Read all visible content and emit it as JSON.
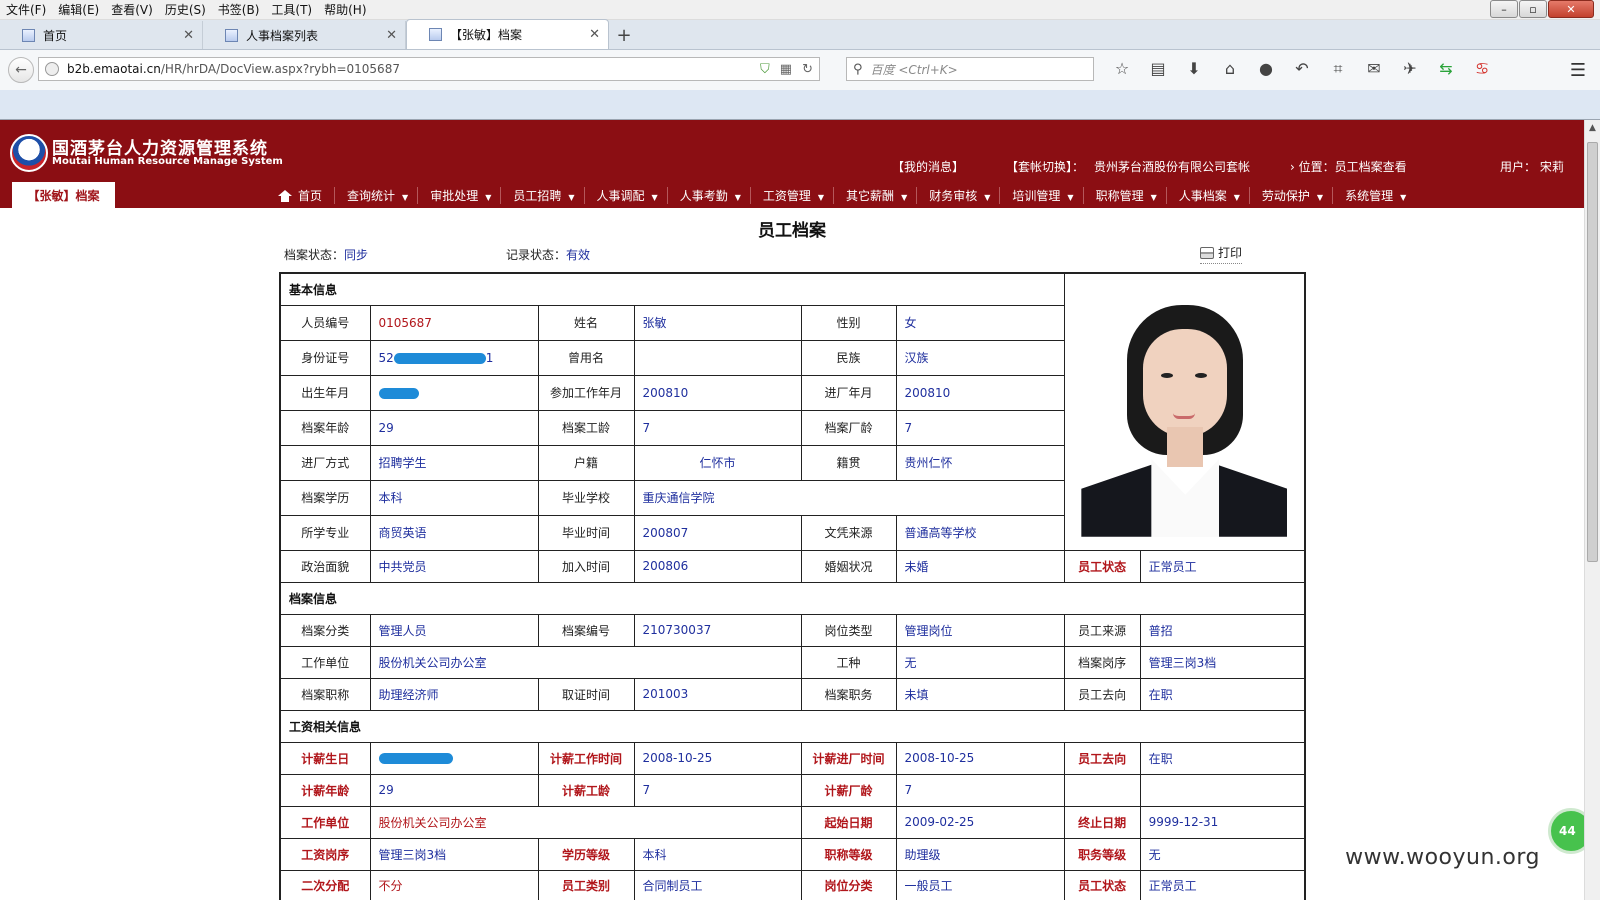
{
  "browser": {
    "menu": [
      "文件(F)",
      "编辑(E)",
      "查看(V)",
      "历史(S)",
      "书签(B)",
      "工具(T)",
      "帮助(H)"
    ],
    "window_buttons": [
      "–",
      "▫",
      "✕"
    ],
    "tabs": [
      {
        "label": "首页"
      },
      {
        "label": "人事档案列表"
      },
      {
        "label": "【张敏】档案"
      }
    ],
    "new_tab": "+",
    "url_host": "b2b.emaotai.cn",
    "url_path": "/HR/hrDA/DocView.aspx?rybh=0105687",
    "search_placeholder": "百度 <Ctrl+K>"
  },
  "system": {
    "title_cn": "国酒茅台人力资源管理系统",
    "title_en": "Moutai Human Resource Manage System",
    "my_messages": "【我的消息】",
    "switch_label": "【套帐切换】：",
    "switch_value": "贵州茅台酒股份有限公司套帐",
    "position": "› 位置：员工档案查看",
    "user": "用户：  宋莉",
    "doc_tab": "【张敏】档案",
    "home": "首页",
    "nav": [
      "查询统计",
      "审批处理",
      "员工招聘",
      "人事调配",
      "人事考勤",
      "工资管理",
      "其它薪酬",
      "财务审核",
      "培训管理",
      "职称管理",
      "人事档案",
      "劳动保护",
      "系统管理"
    ]
  },
  "page": {
    "title": "员工档案",
    "archive_status_label": "档案状态：",
    "archive_status": "同步",
    "record_status_label": "记录状态：",
    "record_status": "有效",
    "print": "打印"
  },
  "sections": {
    "basic": "基本信息",
    "archive": "档案信息",
    "salary": "工资相关信息"
  },
  "basic": {
    "r1": [
      "人员编号",
      "0105687",
      "姓名",
      "张敏",
      "性别",
      "女"
    ],
    "r2": [
      "身份证号",
      "52",
      "1",
      "曾用名",
      "",
      "民族",
      "汉族"
    ],
    "r3": [
      "出生年月",
      "",
      "参加工作年月",
      "200810",
      "进厂年月",
      "200810"
    ],
    "r4": [
      "档案年龄",
      "29",
      "档案工龄",
      "7",
      "档案厂龄",
      "7"
    ],
    "r5": [
      "进厂方式",
      "招聘学生",
      "户籍",
      "仁怀市",
      "籍贯",
      "贵州仁怀"
    ],
    "r6": [
      "档案学历",
      "本科",
      "毕业学校",
      "重庆通信学院"
    ],
    "r7": [
      "所学专业",
      "商贸英语",
      "毕业时间",
      "200807",
      "文凭来源",
      "普通高等学校"
    ],
    "r8": [
      "政治面貌",
      "中共党员",
      "加入时间",
      "200806",
      "婚姻状况",
      "未婚",
      "员工状态",
      "正常员工"
    ]
  },
  "archive": {
    "r1": [
      "档案分类",
      "管理人员",
      "档案编号",
      "210730037",
      "岗位类型",
      "管理岗位",
      "员工来源",
      "普招"
    ],
    "r2": [
      "工作单位",
      "股份机关公司办公室",
      "工种",
      "无",
      "档案岗序",
      "管理三岗3档"
    ],
    "r3": [
      "档案职称",
      "助理经济师",
      "取证时间",
      "201003",
      "档案职务",
      "未填",
      "员工去向",
      "在职"
    ]
  },
  "salary": {
    "r1": [
      "计薪生日",
      "",
      "计薪工作时间",
      "2008-10-25",
      "计薪进厂时间",
      "2008-10-25",
      "员工去向",
      "在职"
    ],
    "r2": [
      "计薪年龄",
      "29",
      "计薪工龄",
      "7",
      "计薪厂龄",
      "7",
      "",
      ""
    ],
    "r3": [
      "工作单位",
      "股份机关公司办公室",
      "起始日期",
      "2009-02-25",
      "终止日期",
      "9999-12-31"
    ],
    "r4": [
      "工资岗序",
      "管理三岗3档",
      "学历等级",
      "本科",
      "职称等级",
      "助理级",
      "职务等级",
      "无"
    ],
    "r5": [
      "二次分配",
      "不分",
      "员工类别",
      "合同制员工",
      "岗位分类",
      "一般员工",
      "员工状态",
      "正常员工"
    ]
  },
  "overlay": {
    "watermark": "www.wooyun.org",
    "badge": "44"
  },
  "colors": {
    "header": "#8b0e13",
    "value_blue": "#1f2f9e",
    "label_red": "#b1161b",
    "redaction": "#1e8bd8"
  }
}
